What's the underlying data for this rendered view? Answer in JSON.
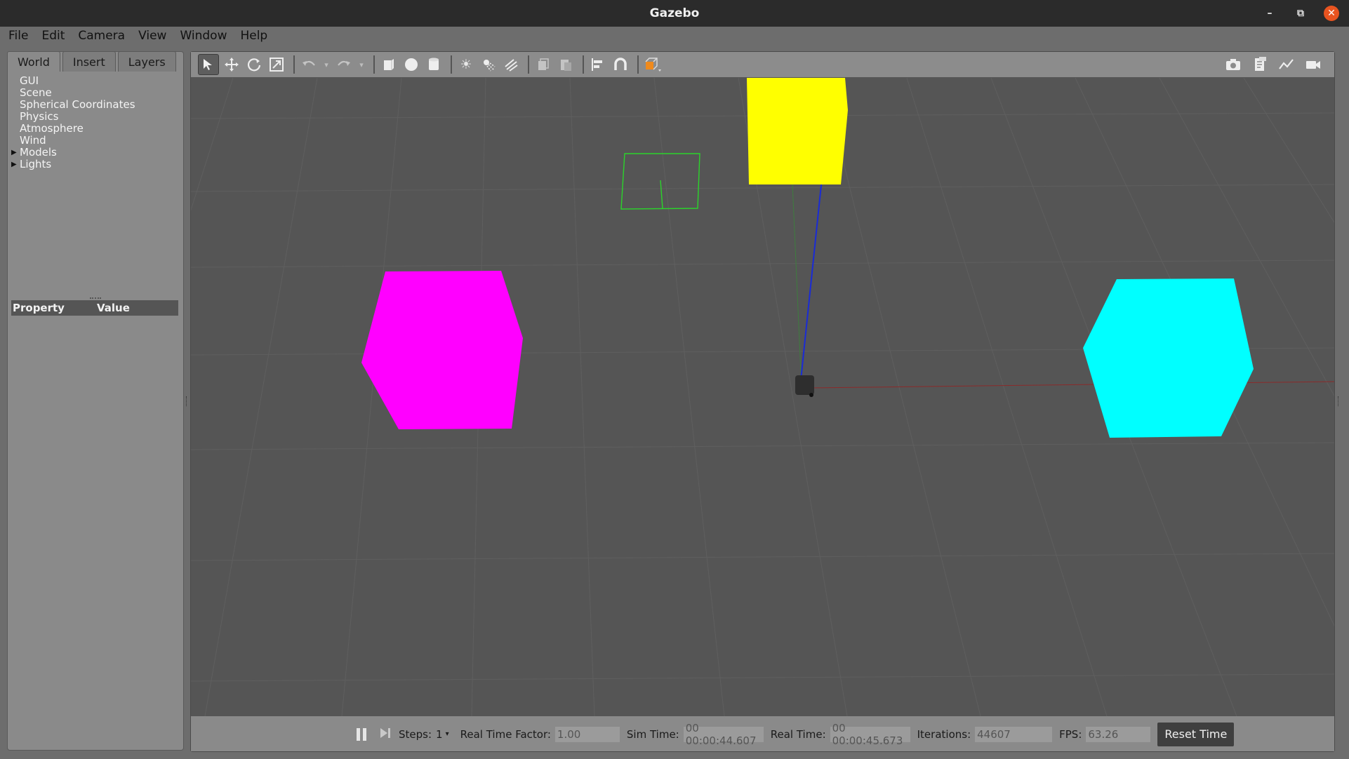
{
  "window": {
    "title": "Gazebo"
  },
  "menu": {
    "items": [
      "File",
      "Edit",
      "Camera",
      "View",
      "Window",
      "Help"
    ]
  },
  "left_panel": {
    "tabs": [
      "World",
      "Insert",
      "Layers"
    ],
    "active_tab": "World",
    "tree": [
      {
        "label": "GUI",
        "expandable": false
      },
      {
        "label": "Scene",
        "expandable": false
      },
      {
        "label": "Spherical Coordinates",
        "expandable": false
      },
      {
        "label": "Physics",
        "expandable": false
      },
      {
        "label": "Atmosphere",
        "expandable": false
      },
      {
        "label": "Wind",
        "expandable": false
      },
      {
        "label": "Models",
        "expandable": true
      },
      {
        "label": "Lights",
        "expandable": true
      }
    ],
    "property_header": {
      "property": "Property",
      "value": "Value"
    }
  },
  "toolbar": {
    "tools": [
      "select-arrow-icon",
      "translate-icon",
      "rotate-icon",
      "scale-icon",
      "undo-icon",
      "redo-icon",
      "box-icon",
      "sphere-icon",
      "cylinder-icon",
      "point-light-icon",
      "spot-light-icon",
      "directional-light-icon",
      "copy-icon",
      "paste-icon",
      "align-icon",
      "snap-icon",
      "view-angle-icon"
    ],
    "right_tools": [
      "screenshot-icon",
      "log-icon",
      "plot-icon",
      "record-video-icon"
    ]
  },
  "scene": {
    "background": "#555555",
    "objects": [
      {
        "name": "magenta-hexagon",
        "color": "#ff00ff"
      },
      {
        "name": "cyan-hexagon",
        "color": "#00ffff"
      },
      {
        "name": "yellow-box",
        "color": "#ffff00"
      },
      {
        "name": "green-wireframe",
        "color": "#22cc22"
      }
    ]
  },
  "status": {
    "steps_label": "Steps:",
    "steps_value": "1",
    "rtf_label": "Real Time Factor:",
    "rtf_value": "1.00",
    "sim_time_label": "Sim Time:",
    "sim_time_value": "00 00:00:44.607",
    "real_time_label": "Real Time:",
    "real_time_value": "00 00:00:45.673",
    "iterations_label": "Iterations:",
    "iterations_value": "44607",
    "fps_label": "FPS:",
    "fps_value": "63.26",
    "reset_label": "Reset Time"
  }
}
